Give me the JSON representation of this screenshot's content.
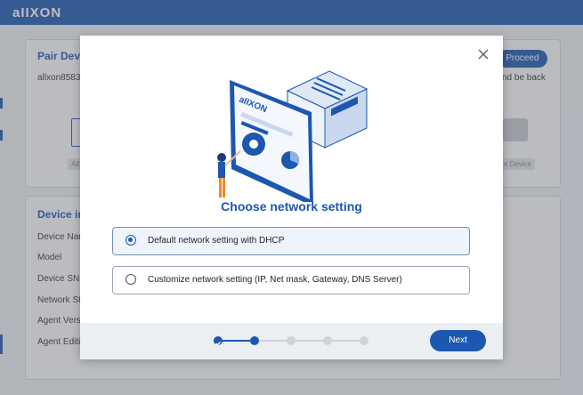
{
  "app": {
    "brand": "aIIXON"
  },
  "background": {
    "pair_card": {
      "title": "Pair Devi",
      "text": "allxon8583",
      "right_text": "nd be back",
      "proceed_label": "Proceed",
      "chip_left": "All",
      "chip_right": "e Device"
    },
    "device_info": {
      "title": "Device in",
      "rows": [
        "Device Nar",
        "Model",
        "Device SN",
        "Network St",
        "Agent Vers",
        "Agent Editi"
      ]
    }
  },
  "modal": {
    "title": "Choose network setting",
    "illustration_label": "aIIXON",
    "options": [
      {
        "label": "Default network setting with DHCP",
        "selected": true
      },
      {
        "label": "Customize network setting (IP, Net mask, Gateway, DNS Server)",
        "selected": false
      }
    ],
    "stepper": {
      "total": 5,
      "current": 2,
      "completed": 1
    },
    "next_label": "Next"
  },
  "colors": {
    "accent": "#1c57b0",
    "topbar": "#1c57b0",
    "inactive_step": "#cfd3d9"
  }
}
